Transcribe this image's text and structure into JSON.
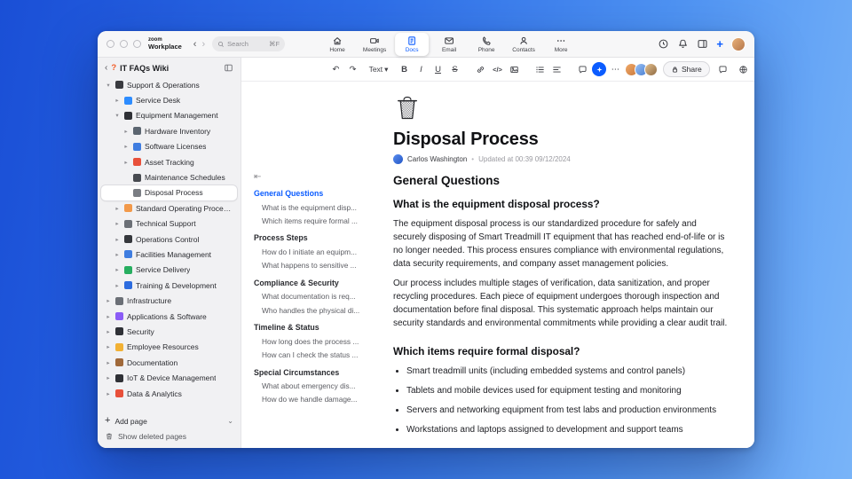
{
  "theme": {
    "accent": "#0B5CFF"
  },
  "titlebar": {
    "brand_top": "zoom",
    "brand_bottom": "Workplace",
    "search_placeholder": "Search",
    "search_shortcut": "⌘F",
    "nav": [
      {
        "label": "Home",
        "icon": "home"
      },
      {
        "label": "Meetings",
        "icon": "meetings"
      },
      {
        "label": "Docs",
        "icon": "docs",
        "active": true
      },
      {
        "label": "Email",
        "icon": "email"
      },
      {
        "label": "Phone",
        "icon": "phone"
      },
      {
        "label": "Contacts",
        "icon": "contacts"
      },
      {
        "label": "More",
        "icon": "more"
      }
    ]
  },
  "sidebar": {
    "title": "IT FAQs Wiki",
    "tree": [
      {
        "label": "Support & Operations",
        "depth": 0,
        "chevron": "down",
        "icon": "phone-icon",
        "icon_color": "#3a3b40"
      },
      {
        "label": "Service Desk",
        "depth": 1,
        "chevron": "right",
        "icon": "headset-icon",
        "icon_color": "#2d8cff"
      },
      {
        "label": "Equipment Management",
        "depth": 1,
        "chevron": "down",
        "icon": "monitor-icon",
        "icon_color": "#2f3136"
      },
      {
        "label": "Hardware Inventory",
        "depth": 2,
        "chevron": "right",
        "icon": "wrench-icon",
        "icon_color": "#5b6570"
      },
      {
        "label": "Software Licenses",
        "depth": 2,
        "chevron": "right",
        "icon": "disc-icon",
        "icon_color": "#3f7de0"
      },
      {
        "label": "Asset Tracking",
        "depth": 2,
        "chevron": "right",
        "icon": "pin-icon",
        "icon_color": "#e8503a"
      },
      {
        "label": "Maintenance Schedules",
        "depth": 2,
        "chevron": "none",
        "icon": "tools-icon",
        "icon_color": "#474a50"
      },
      {
        "label": "Disposal Process",
        "depth": 2,
        "chevron": "none",
        "icon": "trash-icon",
        "icon_color": "#7a7d83",
        "selected": true
      },
      {
        "label": "Standard Operating Procedures",
        "depth": 1,
        "chevron": "right",
        "icon": "clipboard-icon",
        "icon_color": "#f2994a"
      },
      {
        "label": "Technical Support",
        "depth": 1,
        "chevron": "right",
        "icon": "support-icon",
        "icon_color": "#6b6f76"
      },
      {
        "label": "Operations Control",
        "depth": 1,
        "chevron": "right",
        "icon": "controls-icon",
        "icon_color": "#35373c"
      },
      {
        "label": "Facilities Management",
        "depth": 1,
        "chevron": "right",
        "icon": "building-icon",
        "icon_color": "#3f7de0"
      },
      {
        "label": "Service Delivery",
        "depth": 1,
        "chevron": "right",
        "icon": "truck-icon",
        "icon_color": "#27ae60"
      },
      {
        "label": "Training & Development",
        "depth": 1,
        "chevron": "right",
        "icon": "graduation-icon",
        "icon_color": "#2d6cdf"
      },
      {
        "label": "Infrastructure",
        "depth": 0,
        "chevron": "right",
        "icon": "server-icon",
        "icon_color": "#6b6f76"
      },
      {
        "label": "Applications & Software",
        "depth": 0,
        "chevron": "right",
        "icon": "apps-icon",
        "icon_color": "#8b5cf6"
      },
      {
        "label": "Security",
        "depth": 0,
        "chevron": "right",
        "icon": "shield-icon",
        "icon_color": "#2f3136"
      },
      {
        "label": "Employee Resources",
        "depth": 0,
        "chevron": "right",
        "icon": "people-icon",
        "icon_color": "#f2b134"
      },
      {
        "label": "Documentation",
        "depth": 0,
        "chevron": "right",
        "icon": "book-icon",
        "icon_color": "#a0693a"
      },
      {
        "label": "IoT & Device Management",
        "depth": 0,
        "chevron": "right",
        "icon": "chip-icon",
        "icon_color": "#2f3136"
      },
      {
        "label": "Data & Analytics",
        "depth": 0,
        "chevron": "right",
        "icon": "chart-icon",
        "icon_color": "#e8503a"
      }
    ],
    "add_page": "Add page",
    "show_deleted": "Show deleted pages"
  },
  "toolbar": {
    "text_style": "Text",
    "share": "Share",
    "code_glyph": "</>",
    "more_glyph": "⋯",
    "undo_glyph": "↶",
    "redo_glyph": "↷"
  },
  "toc": {
    "sections": [
      {
        "title": "General Questions",
        "active": true,
        "items": [
          "What is the equipment disp...",
          "Which items require formal ..."
        ]
      },
      {
        "title": "Process Steps",
        "items": [
          "How do I initiate an equipm...",
          "What happens to sensitive ..."
        ]
      },
      {
        "title": "Compliance & Security",
        "items": [
          "What documentation is req...",
          "Who handles the physical di..."
        ]
      },
      {
        "title": "Timeline & Status",
        "items": [
          "How long does the process ...",
          "How can I check the status ..."
        ]
      },
      {
        "title": "Special Circumstances",
        "items": [
          "What about emergency dis...",
          "How do we handle damage..."
        ]
      }
    ]
  },
  "doc": {
    "title": "Disposal Process",
    "author": "Carlos Washington",
    "separator": "•",
    "updated": "Updated at 00:39 09/12/2024",
    "h2": "General Questions",
    "sections": [
      {
        "heading": "What is the equipment disposal process?",
        "paragraphs": [
          "The equipment disposal process is our standardized procedure for safely and securely disposing of Smart Treadmill IT equipment that has reached end-of-life or is no longer needed. This process ensures compliance with environmental regulations, data security requirements, and company asset management policies.",
          "Our process includes multiple stages of verification, data sanitization, and proper recycling procedures. Each piece of equipment undergoes thorough inspection and documentation before final disposal. This systematic approach helps maintain our security standards and environmental commitments while providing a clear audit trail."
        ],
        "bullets": []
      },
      {
        "heading": "Which items require formal disposal?",
        "paragraphs": [],
        "bullets": [
          "Smart treadmill units (including embedded systems and control panels)",
          "Tablets and mobile devices used for equipment testing and monitoring",
          "Servers and networking equipment from test labs and production environments",
          "Workstations and laptops assigned to development and support teams"
        ]
      }
    ]
  }
}
